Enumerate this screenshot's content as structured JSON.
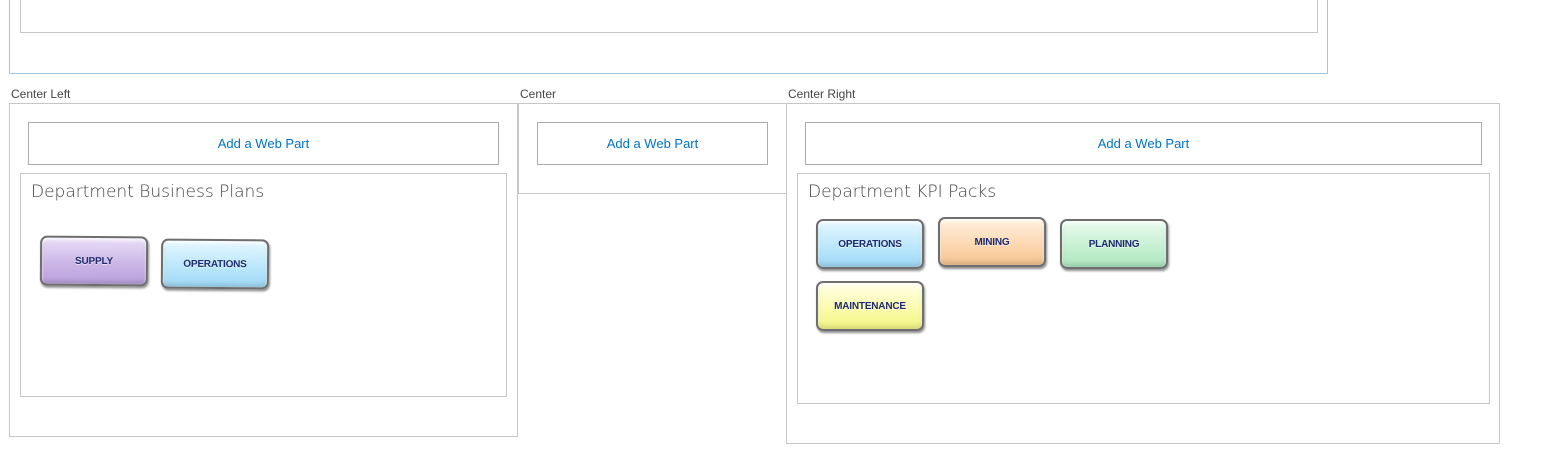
{
  "zones": {
    "center_left": {
      "label": "Center Left",
      "add_part": "Add a Web Part"
    },
    "center": {
      "label": "Center",
      "add_part": "Add a Web Part"
    },
    "center_right": {
      "label": "Center Right",
      "add_part": "Add a Web Part"
    }
  },
  "business_plans": {
    "title": "Department Business Plans",
    "buttons": [
      {
        "label": "SUPPLY",
        "color": "#c9b3e6"
      },
      {
        "label": "OPERATIONS",
        "color": "#b8e6fb"
      }
    ]
  },
  "kpi_packs": {
    "title": "Department KPI Packs",
    "buttons": [
      {
        "label": "OPERATIONS",
        "color": "#b8e6fb"
      },
      {
        "label": "MINING",
        "color": "#fcd6ae"
      },
      {
        "label": "PLANNING",
        "color": "#c4efd0"
      },
      {
        "label": "MAINTENANCE",
        "color": "#fbfba8"
      }
    ]
  },
  "colors": {
    "link": "#0072c6",
    "border": "#c6c6c6",
    "top_zone_border": "#a7c5dc"
  }
}
